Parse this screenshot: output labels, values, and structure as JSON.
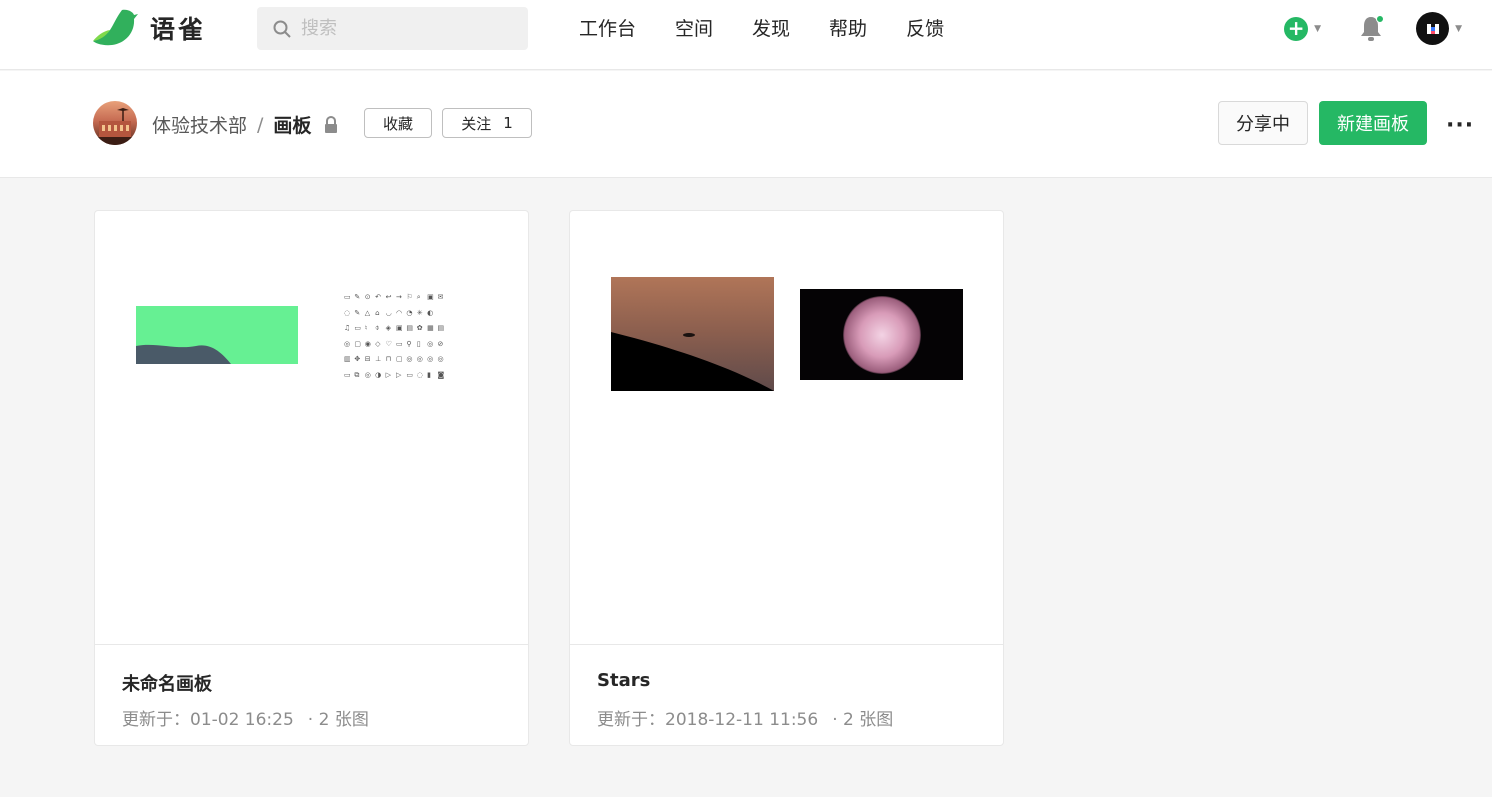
{
  "brand": {
    "name": "语雀",
    "color": "#25b864"
  },
  "search": {
    "placeholder": "搜索"
  },
  "nav": {
    "links": [
      "工作台",
      "空间",
      "发现",
      "帮助",
      "反馈"
    ]
  },
  "header_right": {
    "plus_icon": "plus-circle-icon",
    "bell_icon": "bell-icon",
    "has_notification": true
  },
  "breadcrumb": {
    "group": "体验技术部",
    "separator": "/",
    "current": "画板"
  },
  "actions": {
    "favorite": "收藏",
    "follow": "关注",
    "follow_count": "1",
    "share": "分享中",
    "new_board": "新建画板",
    "more": "···"
  },
  "boards": [
    {
      "title": "未命名画板",
      "updated_label": "更新于：",
      "updated": "01-02 16:25",
      "count": "· 2 张图"
    },
    {
      "title": "Stars",
      "updated_label": "更新于：",
      "updated": "2018-12-11 11:56",
      "count": "· 2 张图"
    }
  ]
}
